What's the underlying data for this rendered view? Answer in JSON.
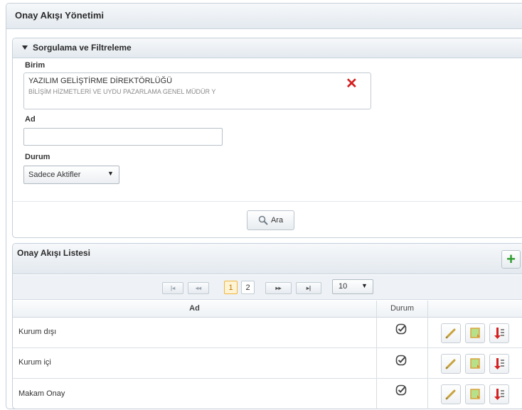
{
  "page": {
    "title": "Onay Akışı Yönetimi"
  },
  "filter": {
    "title": "Sorgulama ve Filtreleme",
    "birim_label": "Birim",
    "birim_value": "YAZILIM GELİŞTİRME DİREKTÖRLÜĞÜ",
    "birim_sub": "BİLİŞİM HİZMETLERİ VE UYDU PAZARLAMA GENEL MÜDÜR Y",
    "ad_label": "Ad",
    "ad_value": "",
    "durum_label": "Durum",
    "durum_value": "Sadece Aktifler",
    "search_label": "Ara"
  },
  "list": {
    "title": "Onay Akışı Listesi",
    "pager": {
      "pages": [
        "1",
        "2"
      ],
      "current": "1",
      "page_size": "10"
    },
    "columns": {
      "ad": "Ad",
      "durum": "Durum"
    },
    "rows": [
      {
        "ad": "Kurum dışı",
        "active": true
      },
      {
        "ad": "Kurum içi",
        "active": true
      },
      {
        "ad": "Makam Onay",
        "active": true
      }
    ]
  },
  "colors": {
    "delete": "#d42020",
    "add": "#2e9b2e",
    "accent": "#f0b53d"
  }
}
